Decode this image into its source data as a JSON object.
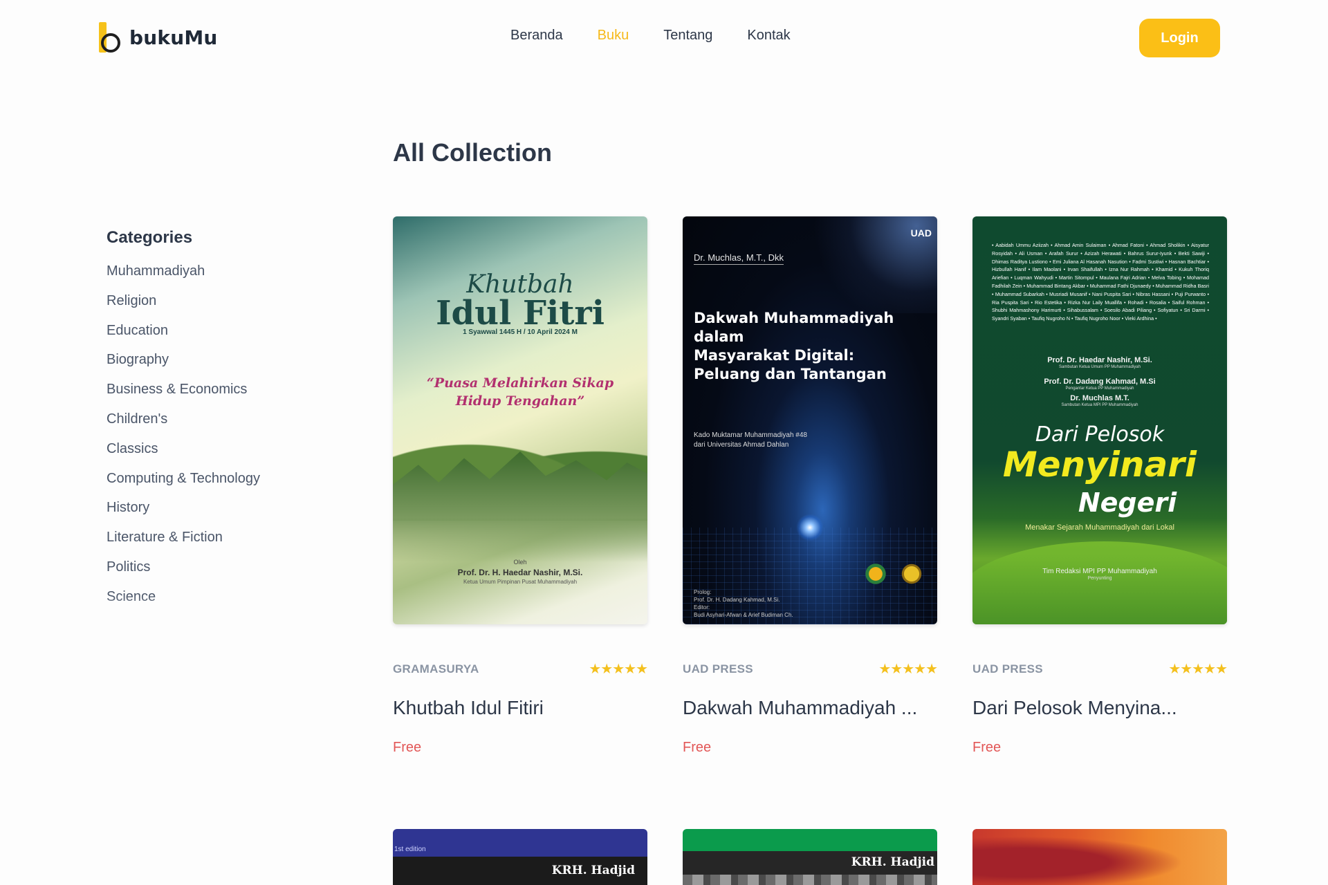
{
  "brand": {
    "name": "bukuMu",
    "accent": "#fbbf16"
  },
  "nav": {
    "items": [
      {
        "label": "Beranda",
        "active": false
      },
      {
        "label": "Buku",
        "active": true
      },
      {
        "label": "Tentang",
        "active": false
      },
      {
        "label": "Kontak",
        "active": false
      }
    ],
    "login_label": "Login"
  },
  "page": {
    "title": "All Collection"
  },
  "sidebar": {
    "title": "Categories",
    "items": [
      "Muhammadiyah",
      "Religion",
      "Education",
      "Biography",
      "Business & Economics",
      "Children's",
      "Classics",
      "Computing & Technology",
      "History",
      "Literature & Fiction",
      "Politics",
      "Science"
    ]
  },
  "books": [
    {
      "publisher": "GRAMASURYA",
      "rating": "★★★★★",
      "title": "Khutbah Idul Fitiri",
      "price": "Free",
      "cover": {
        "script": "Khutbah",
        "big": "Idul Fitri",
        "date": "1 Syawwal 1445 H / 10 April 2024 M",
        "quote": "“Puasa Melahirkan Sikap Hidup Tengahan”",
        "by": "Oleh",
        "author": "Prof. Dr. H. Haedar Nashir, M.Si.",
        "role": "Ketua Umum Pimpinan Pusat Muhammadiyah"
      }
    },
    {
      "publisher": "UAD PRESS",
      "rating": "★★★★★",
      "title": "Dakwah Muhammadiyah ...",
      "price": "Free",
      "cover": {
        "author": "Dr. Muchlas, M.T., Dkk",
        "logo": "UAD",
        "title_lines": [
          "Dakwah Muhammadiyah",
          "dalam",
          "Masyarakat Digital:",
          "Peluang dan Tantangan"
        ],
        "sub_lines": [
          "Kado Muktamar Muhammadiyah #48",
          "dari Universitas Ahmad Dahlan"
        ],
        "credit_lines": [
          "Prolog:",
          "Prof. Dr. H. Dadang Kahmad, M.Si.",
          "Editor:",
          "Budi Asyhari-Afwan & Arief Budiman Ch."
        ]
      }
    },
    {
      "publisher": "UAD PRESS",
      "rating": "★★★★★",
      "title": "Dari Pelosok Menyina...",
      "price": "Free",
      "cover": {
        "names": "• Aabidah Ummu Aziizah • Ahmad Amin Sulaiman • Ahmad Fatoni • Ahmad Sholikin • Aisyatur Rosyidah • Ali Usman • Arafah Surur • Azizah Herawati • Bahrus Surur-Iyunk • Bekti Sawiji • Dhimas Raditya Lustiono • Emi Juliana Al Hasanah Nasution • Fadmi Sustiwi • Hasnan Bachtiar • Hizbullah Hanif • Ilam Maolani • Irvan Shaifullah • Izna Nur Rahmah • Khamid • Kukuh Thoriq Ariefian • Luqman Wahyudi • Martin Sitompul • Maulana Fajri Adrian • Melva Tobing • Mohamad Fadhilah Zein • Muhammad Bintang Akbar • Muhammad Fathi Djunaedy • Muhammad Ridha Basri • Muhammad Subarkah • Musriadi Musanif • Nani Puspita Sari • Nibras Hassani • Puji Purwanto • Ria Puspita Sari • Rio Estetika • Rizka Nur Laily Muallifa • Rohadi • Rosalia • Saiful Rohman • Shubhi Mahmashony Harimurti • Sihabussalam • Soesilo Abadi Piliang • Sofiyatun • Sri Darmi • Syandri Syaban • Taufiq Nugroho N • Taufiq Nugroho Noor • Vieki Ardhina •",
        "person1": "Prof. Dr. Haedar Nashir, M.Si.",
        "person1_role": "Sambutan Ketua Umum PP Muhammadiyah",
        "person2": "Prof. Dr. Dadang Kahmad, M.Si",
        "person2_role": "Pengantar Ketua PP Muhammadiyah",
        "person3": "Dr. Muchlas M.T.",
        "person3_role": "Sambutan Ketua MPI PP Muhammadiyah",
        "title1": "Dari Pelosok",
        "title2": "Menyinari",
        "title3": "Negeri",
        "tagline": "Menakar Sejarah Muhammadiyah dari Lokal",
        "team": "Tim Redaksi MPI PP Muhammadiyah",
        "team_role": "Penyunting"
      }
    }
  ],
  "row2": [
    {
      "edition": "1st edition",
      "name": "KRH. Hadjid"
    },
    {
      "name": "KRH. Hadjid"
    },
    {}
  ]
}
